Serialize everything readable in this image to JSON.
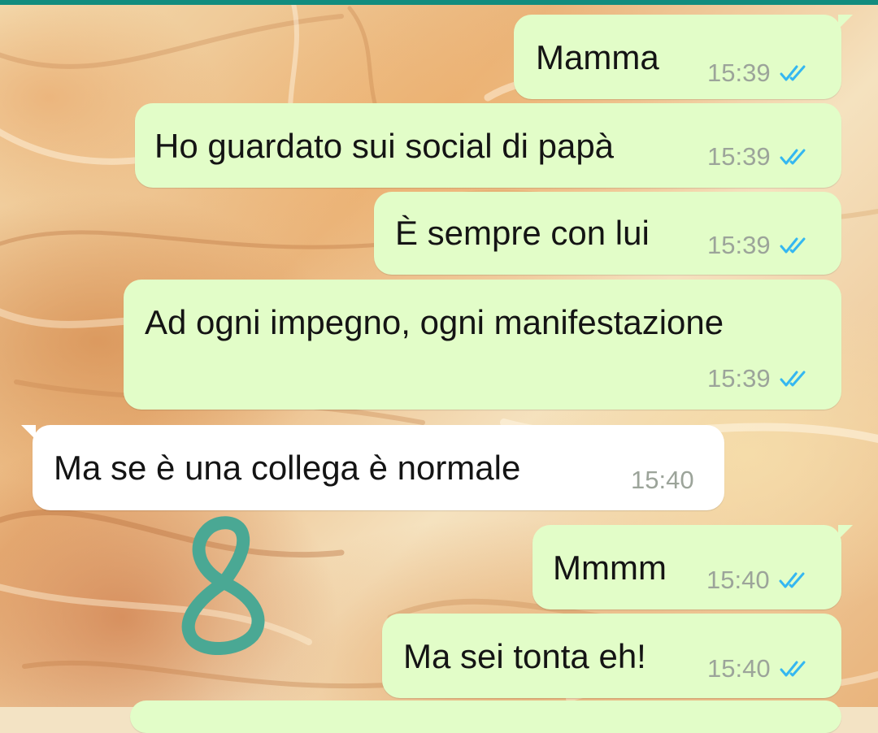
{
  "colors": {
    "header": "#128c7e",
    "outgoing_bubble": "#e2fdc8",
    "incoming_bubble": "#ffffff",
    "read_ticks": "#34b7f1",
    "time_text": "#9ca49a",
    "doodle": "#4aa894"
  },
  "messages": [
    {
      "direction": "outgoing",
      "text": "Mamma",
      "time": "15:39",
      "status_icon": "double-check-read-icon"
    },
    {
      "direction": "outgoing",
      "text": "Ho guardato sui social di papà",
      "time": "15:39",
      "status_icon": "double-check-read-icon"
    },
    {
      "direction": "outgoing",
      "text": "È sempre con lui",
      "time": "15:39",
      "status_icon": "double-check-read-icon"
    },
    {
      "direction": "outgoing",
      "text": "Ad ogni impegno, ogni manifestazione",
      "time": "15:39",
      "status_icon": "double-check-read-icon"
    },
    {
      "direction": "incoming",
      "text": "Ma se è una collega è normale",
      "time": "15:40"
    },
    {
      "direction": "outgoing",
      "text": "Mmmm",
      "time": "15:40",
      "status_icon": "double-check-read-icon"
    },
    {
      "direction": "outgoing",
      "text": "Ma sei tonta eh!",
      "time": "15:40",
      "status_icon": "double-check-read-icon"
    }
  ],
  "annotation": {
    "icon": "hand-drawn-eight-doodle"
  }
}
